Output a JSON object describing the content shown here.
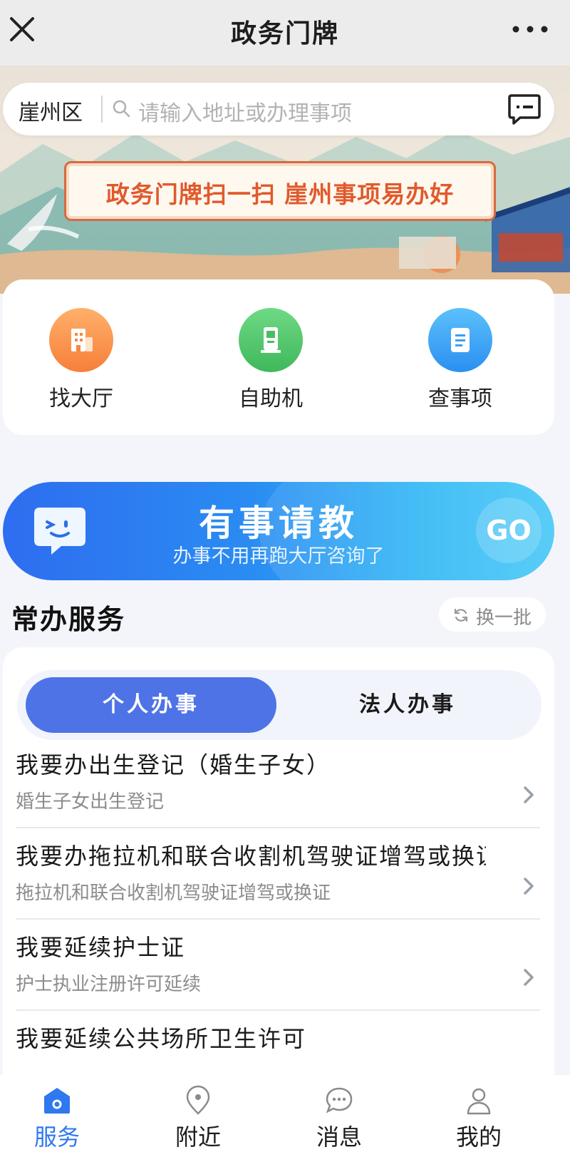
{
  "header": {
    "title": "政务门牌"
  },
  "search": {
    "region": "崖州区",
    "placeholder": "请输入地址或办理事项"
  },
  "banner": {
    "slogan": "政务门牌扫一扫 崖州事项易办好"
  },
  "quick_actions": [
    {
      "label": "找大厅",
      "icon": "building-icon",
      "color": "#f7924a"
    },
    {
      "label": "自助机",
      "icon": "kiosk-icon",
      "color": "#4cc56a"
    },
    {
      "label": "查事项",
      "icon": "document-icon",
      "color": "#3aa8f6"
    }
  ],
  "ask_banner": {
    "title": "有事请教",
    "subtitle": "办事不用再跑大厅咨询了",
    "go": "GO"
  },
  "common_services": {
    "title": "常办服务",
    "refresh_label": "换一批",
    "tabs": [
      {
        "label": "个人办事",
        "active": true
      },
      {
        "label": "法人办事",
        "active": false
      }
    ],
    "items": [
      {
        "title": "我要办出生登记（婚生子女）",
        "subtitle": "婚生子女出生登记"
      },
      {
        "title": "我要办拖拉机和联合收割机驾驶证增驾或换证",
        "subtitle": "拖拉机和联合收割机驾驶证增驾或换证"
      },
      {
        "title": "我要延续护士证",
        "subtitle": "护士执业注册许可延续"
      },
      {
        "title": "我要延续公共场所卫生许可",
        "subtitle": ""
      }
    ]
  },
  "bottom_nav": [
    {
      "label": "服务",
      "icon": "home-icon",
      "active": true
    },
    {
      "label": "附近",
      "icon": "location-icon",
      "active": false
    },
    {
      "label": "消息",
      "icon": "chat-icon",
      "active": false
    },
    {
      "label": "我的",
      "icon": "user-icon",
      "active": false
    }
  ],
  "colors": {
    "accent": "#4e73e6",
    "nav_active": "#2f78f0",
    "slogan": "#e05a2c"
  }
}
